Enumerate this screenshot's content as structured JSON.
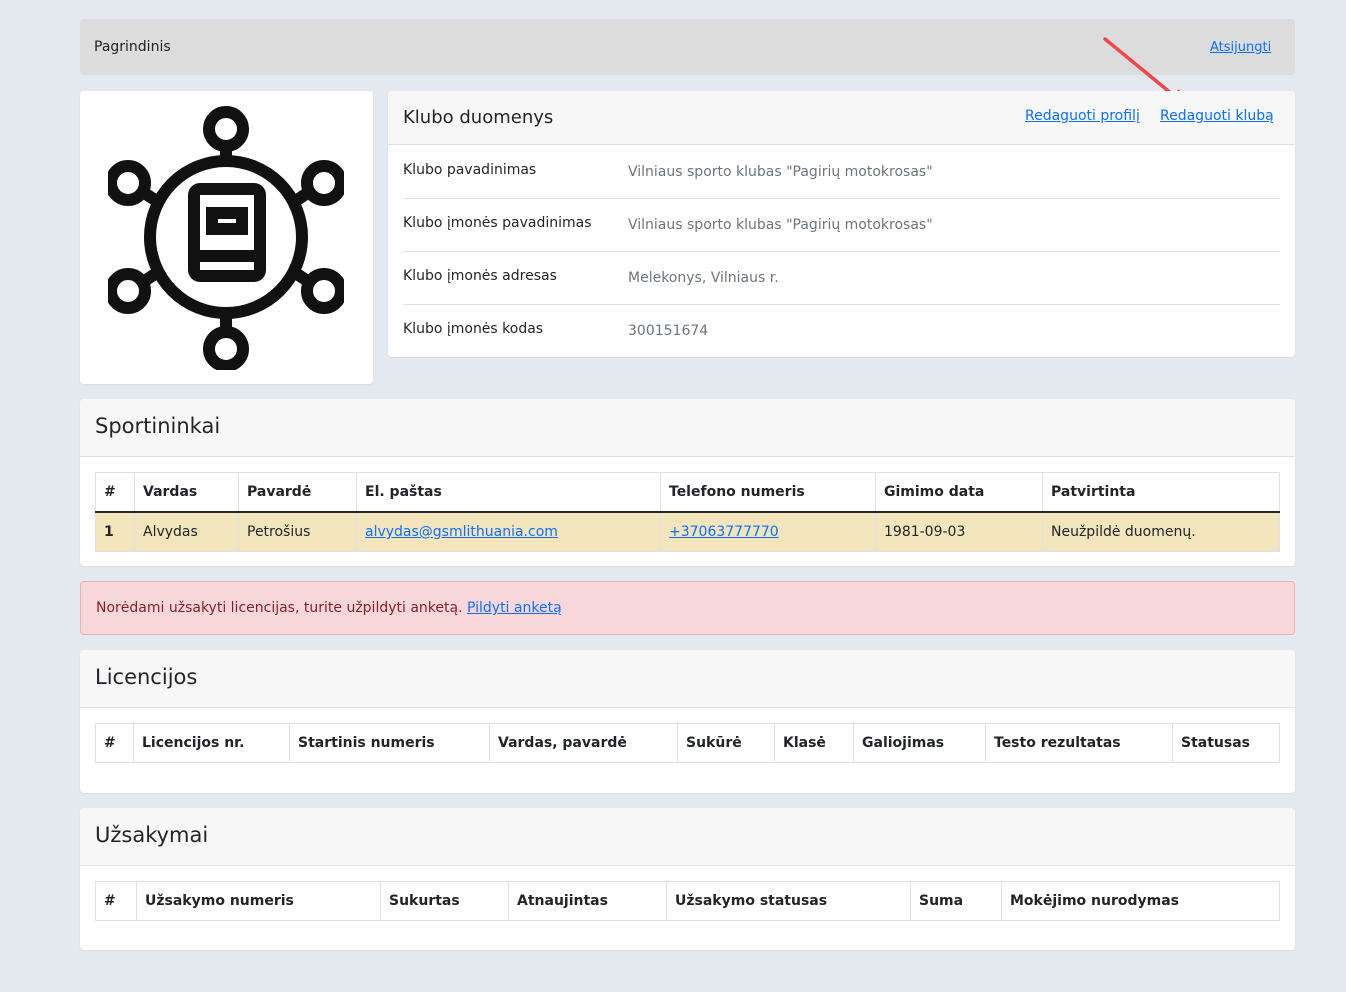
{
  "navbar": {
    "brand": "Pagrindinis",
    "logout": "Atsijungti"
  },
  "club": {
    "title": "Klubo duomenys",
    "edit_profile": "Redaguoti profilį",
    "edit_club": "Redaguoti klubą",
    "rows": [
      {
        "label": "Klubo pavadinimas",
        "value": "Vilniaus sporto klubas \"Pagirių motokrosas\""
      },
      {
        "label": "Klubo įmonės pavadinimas",
        "value": "Vilniaus sporto klubas \"Pagirių motokrosas\""
      },
      {
        "label": "Klubo įmonės adresas",
        "value": "Melekonys, Vilniaus r."
      },
      {
        "label": "Klubo įmonės kodas",
        "value": "300151674"
      }
    ]
  },
  "athletes": {
    "title": "Sportininkai",
    "columns": [
      "#",
      "Vardas",
      "Pavardė",
      "El. paštas",
      "Telefono numeris",
      "Gimimo data",
      "Patvirtinta"
    ],
    "rows": [
      {
        "num": "1",
        "first": "Alvydas",
        "last": "Petrošius",
        "email": "alvydas@gsmlithuania.com",
        "phone": "+37063777770",
        "birth": "1981-09-03",
        "confirmed": "Neužpildė duomenų."
      }
    ]
  },
  "alert": {
    "text": "Norėdami užsakyti licencijas, turite užpildyti anketą.",
    "link": "Pildyti anketą"
  },
  "licenses": {
    "title": "Licencijos",
    "columns": [
      "#",
      "Licencijos nr.",
      "Startinis numeris",
      "Vardas, pavardė",
      "Sukūrė",
      "Klasė",
      "Galiojimas",
      "Testo rezultatas",
      "Statusas"
    ]
  },
  "orders": {
    "title": "Užsakymai",
    "columns": [
      "#",
      "Užsakymo numeris",
      "Sukurtas",
      "Atnaujintas",
      "Užsakymo statusas",
      "Suma",
      "Mokėjimo nurodymas"
    ]
  },
  "colors": {
    "link": "#0d6efd",
    "alert_bg": "#f8d7da",
    "row_highlight": "#f3e5bb",
    "arrow": "#f04848"
  },
  "icons": {
    "logo": "club-network-book-icon",
    "annotation": "red-arrow-annotation"
  }
}
